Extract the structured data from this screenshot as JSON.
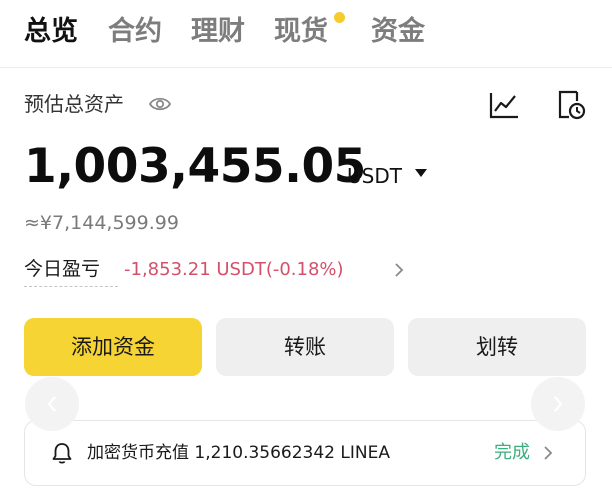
{
  "tabs": [
    {
      "label": "总览",
      "active": true
    },
    {
      "label": "合约",
      "active": false
    },
    {
      "label": "理财",
      "active": false
    },
    {
      "label": "现货",
      "active": false,
      "has_dot": true
    },
    {
      "label": "资金",
      "active": false
    }
  ],
  "assets": {
    "label": "预估总资产",
    "balance": "1,003,455.05",
    "currency": "USDT",
    "approx": "≈¥7,144,599.99"
  },
  "pnl": {
    "label": "今日盈亏",
    "value": "-1,853.21 USDT(-0.18%)"
  },
  "actions": {
    "deposit": "添加资金",
    "transfer": "转账",
    "convert": "划转"
  },
  "notice": {
    "text": "加密货币充值 1,210.35662342 LINEA",
    "status": "完成"
  },
  "icons": {
    "eye": "eye-icon",
    "chart": "line-chart-icon",
    "history": "history-icon",
    "caret": "caret-down-icon",
    "chevron": "chevron-right-icon",
    "bell": "bell-icon"
  },
  "colors": {
    "accent": "#f6d434",
    "negative": "#d4506a",
    "success": "#3dae7e",
    "dot": "#f5cc2c"
  }
}
